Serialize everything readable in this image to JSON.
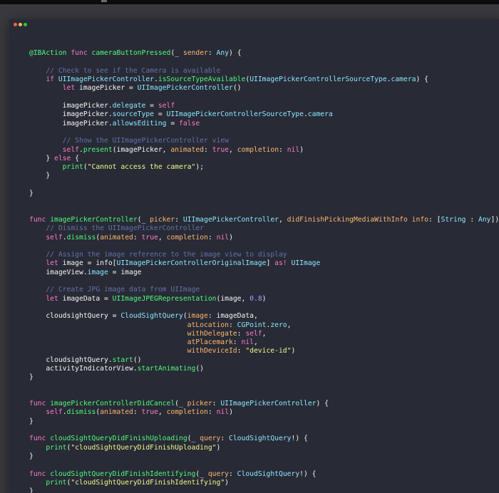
{
  "window": {
    "dot_colors": [
      "#ff5f56",
      "#ffbd2e",
      "#27c93f"
    ]
  },
  "editor": {
    "lines": [
      [],
      [
        [
          "attr",
          "@IBAction"
        ],
        [
          "pl",
          " "
        ],
        [
          "kw",
          "func"
        ],
        [
          "pl",
          " "
        ],
        [
          "fn",
          "cameraButtonPressed"
        ],
        [
          "pl",
          "(_ "
        ],
        [
          "param",
          "sender"
        ],
        [
          "pl",
          ": "
        ],
        [
          "type",
          "Any"
        ],
        [
          "pl",
          ") {"
        ]
      ],
      [],
      [
        [
          "pl",
          "    "
        ],
        [
          "com",
          "// Check to see if the Camera is available"
        ]
      ],
      [
        [
          "pl",
          "    "
        ],
        [
          "kw",
          "if"
        ],
        [
          "pl",
          " "
        ],
        [
          "type",
          "UIImagePickerController"
        ],
        [
          "pl",
          "."
        ],
        [
          "fn",
          "isSourceTypeAvailable"
        ],
        [
          "pl",
          "("
        ],
        [
          "type",
          "UIImagePickerControllerSourceType"
        ],
        [
          "pl",
          "."
        ],
        [
          "type",
          "camera"
        ],
        [
          "pl",
          ") {"
        ]
      ],
      [
        [
          "pl",
          "        "
        ],
        [
          "kw",
          "let"
        ],
        [
          "pl",
          " imagePicker = "
        ],
        [
          "type",
          "UIImagePickerController"
        ],
        [
          "pl",
          "()"
        ]
      ],
      [],
      [
        [
          "pl",
          "        imagePicker."
        ],
        [
          "type",
          "delegate"
        ],
        [
          "pl",
          " = "
        ],
        [
          "kw",
          "self"
        ]
      ],
      [
        [
          "pl",
          "        imagePicker."
        ],
        [
          "type",
          "sourceType"
        ],
        [
          "pl",
          " = "
        ],
        [
          "type",
          "UIImagePickerControllerSourceType"
        ],
        [
          "pl",
          "."
        ],
        [
          "type",
          "camera"
        ]
      ],
      [
        [
          "pl",
          "        imagePicker."
        ],
        [
          "type",
          "allowsEditing"
        ],
        [
          "pl",
          " = "
        ],
        [
          "kw",
          "false"
        ]
      ],
      [],
      [
        [
          "pl",
          "        "
        ],
        [
          "com",
          "// Show the UIImagePickerController view"
        ]
      ],
      [
        [
          "pl",
          "        "
        ],
        [
          "kw",
          "self"
        ],
        [
          "pl",
          "."
        ],
        [
          "fn",
          "present"
        ],
        [
          "pl",
          "(imagePicker, "
        ],
        [
          "param",
          "animated"
        ],
        [
          "pl",
          ": "
        ],
        [
          "kw",
          "true"
        ],
        [
          "pl",
          ", "
        ],
        [
          "param",
          "completion"
        ],
        [
          "pl",
          ": "
        ],
        [
          "kw",
          "nil"
        ],
        [
          "pl",
          ")"
        ]
      ],
      [
        [
          "pl",
          "    } "
        ],
        [
          "kw",
          "else"
        ],
        [
          "pl",
          " {"
        ]
      ],
      [
        [
          "pl",
          "        "
        ],
        [
          "fn",
          "print"
        ],
        [
          "pl",
          "("
        ],
        [
          "str",
          "\"Cannot access the camera\""
        ],
        [
          "pl",
          ");"
        ]
      ],
      [
        [
          "pl",
          "    }"
        ]
      ],
      [],
      [
        [
          "pl",
          "}"
        ]
      ],
      [],
      [],
      [
        [
          "kw",
          "func"
        ],
        [
          "pl",
          " "
        ],
        [
          "fn",
          "imagePickerController"
        ],
        [
          "pl",
          "(_ "
        ],
        [
          "param",
          "picker"
        ],
        [
          "pl",
          ": "
        ],
        [
          "type",
          "UIImagePickerController"
        ],
        [
          "pl",
          ", "
        ],
        [
          "param",
          "didFinishPickingMediaWithInfo"
        ],
        [
          "pl",
          " "
        ],
        [
          "param",
          "info"
        ],
        [
          "pl",
          ": ["
        ],
        [
          "type",
          "String"
        ],
        [
          "pl",
          " : "
        ],
        [
          "type",
          "Any"
        ],
        [
          "pl",
          "]) {"
        ]
      ],
      [
        [
          "pl",
          "    "
        ],
        [
          "com",
          "// Dismiss the UIImagePickerController"
        ]
      ],
      [
        [
          "pl",
          "    "
        ],
        [
          "kw",
          "self"
        ],
        [
          "pl",
          "."
        ],
        [
          "fn",
          "dismiss"
        ],
        [
          "pl",
          "("
        ],
        [
          "param",
          "animated"
        ],
        [
          "pl",
          ": "
        ],
        [
          "kw",
          "true"
        ],
        [
          "pl",
          ", "
        ],
        [
          "param",
          "completion"
        ],
        [
          "pl",
          ": "
        ],
        [
          "kw",
          "nil"
        ],
        [
          "pl",
          ")"
        ]
      ],
      [],
      [
        [
          "pl",
          "    "
        ],
        [
          "com",
          "// Assign the image reference to the image view to display"
        ]
      ],
      [
        [
          "pl",
          "    "
        ],
        [
          "kw",
          "let"
        ],
        [
          "pl",
          " image = info["
        ],
        [
          "type",
          "UIImagePickerControllerOriginalImage"
        ],
        [
          "pl",
          "] "
        ],
        [
          "kw",
          "as!"
        ],
        [
          "pl",
          " "
        ],
        [
          "type",
          "UIImage"
        ]
      ],
      [
        [
          "pl",
          "    imageView."
        ],
        [
          "type",
          "image"
        ],
        [
          "pl",
          " = image"
        ]
      ],
      [],
      [
        [
          "pl",
          "    "
        ],
        [
          "com",
          "// Create JPG image data from UIImage"
        ]
      ],
      [
        [
          "pl",
          "    "
        ],
        [
          "kw",
          "let"
        ],
        [
          "pl",
          " imageData = "
        ],
        [
          "fn",
          "UIImageJPEGRepresentation"
        ],
        [
          "pl",
          "(image, "
        ],
        [
          "num",
          "0.8"
        ],
        [
          "pl",
          ")"
        ]
      ],
      [],
      [
        [
          "pl",
          "    cloudsightQuery = "
        ],
        [
          "type",
          "CloudSightQuery"
        ],
        [
          "pl",
          "("
        ],
        [
          "param",
          "image"
        ],
        [
          "pl",
          ": imageData,"
        ]
      ],
      [
        [
          "pl",
          "                                      "
        ],
        [
          "param",
          "atLocation"
        ],
        [
          "pl",
          ": "
        ],
        [
          "type",
          "CGPoint"
        ],
        [
          "pl",
          "."
        ],
        [
          "type",
          "zero"
        ],
        [
          "pl",
          ","
        ]
      ],
      [
        [
          "pl",
          "                                      "
        ],
        [
          "param",
          "withDelegate"
        ],
        [
          "pl",
          ": "
        ],
        [
          "kw",
          "self"
        ],
        [
          "pl",
          ","
        ]
      ],
      [
        [
          "pl",
          "                                      "
        ],
        [
          "param",
          "atPlacemark"
        ],
        [
          "pl",
          ": "
        ],
        [
          "kw",
          "nil"
        ],
        [
          "pl",
          ","
        ]
      ],
      [
        [
          "pl",
          "                                      "
        ],
        [
          "param",
          "withDeviceId"
        ],
        [
          "pl",
          ": "
        ],
        [
          "str",
          "\"device-id\""
        ],
        [
          "pl",
          ")"
        ]
      ],
      [
        [
          "pl",
          "    cloudsightQuery."
        ],
        [
          "fn",
          "start"
        ],
        [
          "pl",
          "()"
        ]
      ],
      [
        [
          "pl",
          "    activityIndicatorView."
        ],
        [
          "fn",
          "startAnimating"
        ],
        [
          "pl",
          "()"
        ]
      ],
      [
        [
          "pl",
          "}"
        ]
      ],
      [],
      [],
      [
        [
          "kw",
          "func"
        ],
        [
          "pl",
          " "
        ],
        [
          "fn",
          "imagePickerControllerDidCancel"
        ],
        [
          "pl",
          "(_ "
        ],
        [
          "param",
          "picker"
        ],
        [
          "pl",
          ": "
        ],
        [
          "type",
          "UIImagePickerController"
        ],
        [
          "pl",
          ") {"
        ]
      ],
      [
        [
          "pl",
          "    "
        ],
        [
          "kw",
          "self"
        ],
        [
          "pl",
          "."
        ],
        [
          "fn",
          "dismiss"
        ],
        [
          "pl",
          "("
        ],
        [
          "param",
          "animated"
        ],
        [
          "pl",
          ": "
        ],
        [
          "kw",
          "true"
        ],
        [
          "pl",
          ", "
        ],
        [
          "param",
          "completion"
        ],
        [
          "pl",
          ": "
        ],
        [
          "kw",
          "nil"
        ],
        [
          "pl",
          ")"
        ]
      ],
      [
        [
          "pl",
          "}"
        ]
      ],
      [],
      [
        [
          "kw",
          "func"
        ],
        [
          "pl",
          " "
        ],
        [
          "fn",
          "cloudSightQueryDidFinishUploading"
        ],
        [
          "pl",
          "(_ "
        ],
        [
          "param",
          "query"
        ],
        [
          "pl",
          ": "
        ],
        [
          "type",
          "CloudSightQuery"
        ],
        [
          "pl",
          "!) {"
        ]
      ],
      [
        [
          "pl",
          "    "
        ],
        [
          "fn",
          "print"
        ],
        [
          "pl",
          "("
        ],
        [
          "str",
          "\"cloudSightQueryDidFinishUploading\""
        ],
        [
          "pl",
          ")"
        ]
      ],
      [
        [
          "pl",
          "}"
        ]
      ],
      [],
      [
        [
          "kw",
          "func"
        ],
        [
          "pl",
          " "
        ],
        [
          "fn",
          "cloudSightQueryDidFinishIdentifying"
        ],
        [
          "pl",
          "(_ "
        ],
        [
          "param",
          "query"
        ],
        [
          "pl",
          ": "
        ],
        [
          "type",
          "CloudSightQuery"
        ],
        [
          "pl",
          "!) {"
        ]
      ],
      [
        [
          "pl",
          "    "
        ],
        [
          "fn",
          "print"
        ],
        [
          "pl",
          "("
        ],
        [
          "str",
          "\"cloudSightQueryDidFinishIdentifying\""
        ],
        [
          "pl",
          ")"
        ]
      ],
      [
        [
          "pl",
          "}"
        ]
      ]
    ]
  }
}
